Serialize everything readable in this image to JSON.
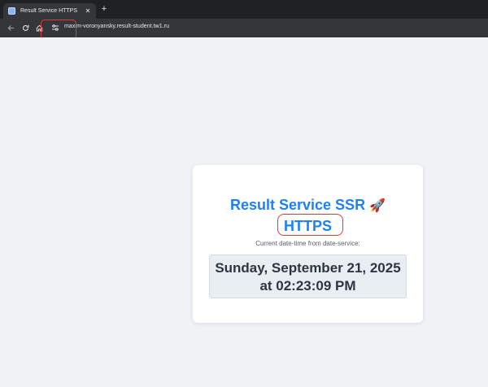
{
  "browser": {
    "tab": {
      "title": "Result Service HTTPS",
      "favicon": "page-icon",
      "close_glyph": "✕"
    },
    "new_tab_glyph": "+",
    "toolbar": {
      "back_icon": "back-arrow-icon",
      "reload_icon": "reload-icon",
      "home_icon": "home-icon",
      "site_info_icon": "site-settings-icon",
      "url": "maxim-voronyansky.result-student.tw1.ru"
    }
  },
  "card": {
    "title": "Result Service SSR",
    "title_emoji": "🚀",
    "protocol": "HTTPS",
    "caption": "Current date-time from date-service:",
    "date_line": "Sunday, September 21, 2025",
    "time_line": "at 02:23:09 PM"
  },
  "colors": {
    "accent": "#1e80f5",
    "annotation": "#e53935",
    "page_background": "#f0f2f5",
    "browser_frame": "#202124",
    "toolbar": "#35363a"
  }
}
